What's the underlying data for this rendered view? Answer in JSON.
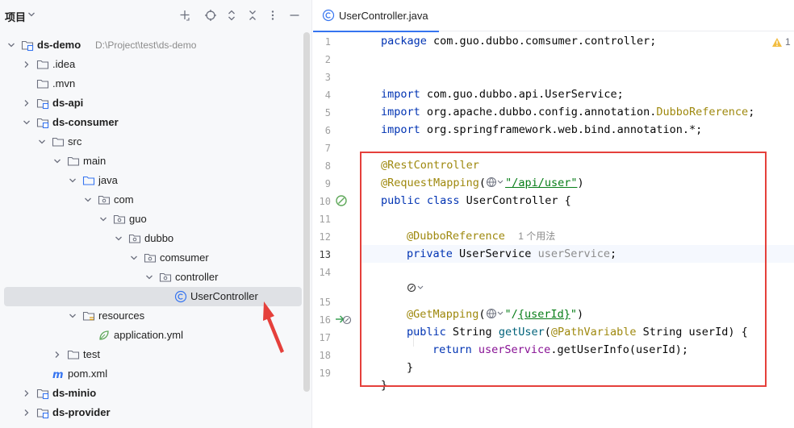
{
  "project": {
    "title": "项目",
    "tree": [
      {
        "label": "ds-demo",
        "path": "D:\\Project\\test\\ds-demo",
        "bold": true,
        "icon": "module-folder-icon",
        "expanded": true
      },
      {
        "label": ".idea",
        "icon": "folder-icon",
        "expanded": false
      },
      {
        "label": ".mvn",
        "icon": "folder-icon"
      },
      {
        "label": "ds-api",
        "bold": true,
        "icon": "module-folder-icon",
        "expanded": false
      },
      {
        "label": "ds-consumer",
        "bold": true,
        "icon": "module-folder-icon",
        "expanded": true
      },
      {
        "label": "src",
        "icon": "folder-icon",
        "expanded": true
      },
      {
        "label": "main",
        "icon": "folder-icon",
        "expanded": true
      },
      {
        "label": "java",
        "icon": "source-folder-icon",
        "expanded": true
      },
      {
        "label": "com",
        "icon": "package-icon",
        "expanded": true
      },
      {
        "label": "guo",
        "icon": "package-icon",
        "expanded": true
      },
      {
        "label": "dubbo",
        "icon": "package-icon",
        "expanded": true
      },
      {
        "label": "comsumer",
        "icon": "package-icon",
        "expanded": true
      },
      {
        "label": "controller",
        "icon": "package-icon",
        "expanded": true
      },
      {
        "label": "UserController",
        "icon": "class-icon",
        "selected": true
      },
      {
        "label": "resources",
        "icon": "resources-folder-icon",
        "expanded": true
      },
      {
        "label": "application.yml",
        "icon": "yaml-file-icon"
      },
      {
        "label": "test",
        "icon": "folder-icon",
        "expanded": false
      },
      {
        "label": "pom.xml",
        "icon": "maven-icon"
      },
      {
        "label": "ds-minio",
        "bold": true,
        "icon": "module-folder-icon",
        "expanded": false
      },
      {
        "label": "ds-provider",
        "bold": true,
        "icon": "module-folder-icon",
        "expanded": false
      }
    ]
  },
  "editor": {
    "tab_label": "UserController.java",
    "warning_count": "1",
    "current_line": 13,
    "line_numbers": [
      "1",
      "2",
      "3",
      "4",
      "5",
      "6",
      "7",
      "8",
      "9",
      "10",
      "11",
      "12",
      "13",
      "14",
      "15",
      "16",
      "17",
      "18",
      "19"
    ],
    "code": {
      "l1_kw": "package",
      "l1_rest": " com.guo.dubbo.comsumer.controller;",
      "l4_kw": "import",
      "l4_rest": " com.guo.dubbo.api.UserService;",
      "l5_kw": "import",
      "l5_rest": " org.apache.dubbo.config.annotation.",
      "l5_ann": "DubboReference",
      "l5_end": ";",
      "l6_kw": "import",
      "l6_rest": " org.springframework.web.bind.annotation.*;",
      "l8_ann": "@RestController",
      "l9_ann": "@RequestMapping",
      "l9_open": "(",
      "l9_str": "\"/api/user\"",
      "l9_close": ")",
      "l10_kw": "public class",
      "l10_rest": " UserController {",
      "l12_ann": "@DubboReference",
      "l12_hint": "1 个用法",
      "l13_kw": "private",
      "l13_type": " UserService ",
      "l13_fld": "userService",
      "l13_end": ";",
      "l15_ann": "@GetMapping",
      "l15_open": "(",
      "l15_str_a": "\"/",
      "l15_str_b": "{userId}",
      "l15_str_c": "\"",
      "l15_close": ")",
      "l16_kw": "public",
      "l16_type": " String ",
      "l16_mth": "getUser",
      "l16_open": "(",
      "l16_ann": "@PathVariable",
      "l16_rest": " String userId) {",
      "l17_kw": "return",
      "l17_fld": " userService",
      "l17_rest": ".getUserInfo(userId);",
      "l18": "}",
      "l19": "}"
    }
  },
  "colors": {
    "accent": "#3574f0",
    "highlight_box": "#e5403b",
    "arrow": "#e5403b"
  }
}
